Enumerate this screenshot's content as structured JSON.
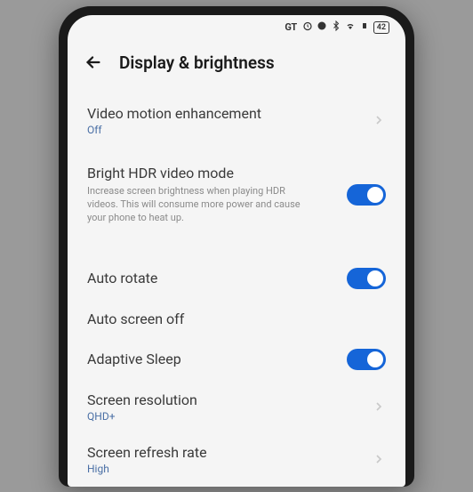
{
  "statusBar": {
    "gt": "GT",
    "battery": "42"
  },
  "header": {
    "title": "Display & brightness"
  },
  "settings": {
    "videoMotion": {
      "title": "Video motion enhancement",
      "status": "Off"
    },
    "brightHdr": {
      "title": "Bright HDR video mode",
      "description": "Increase screen brightness when playing HDR videos. This will consume more power and cause your phone to heat up.",
      "enabled": true
    },
    "autoRotate": {
      "title": "Auto rotate",
      "enabled": true
    },
    "autoScreenOff": {
      "title": "Auto screen off"
    },
    "adaptiveSleep": {
      "title": "Adaptive Sleep",
      "enabled": true
    },
    "screenResolution": {
      "title": "Screen resolution",
      "value": "QHD+"
    },
    "screenRefreshRate": {
      "title": "Screen refresh rate",
      "value": "High"
    }
  }
}
